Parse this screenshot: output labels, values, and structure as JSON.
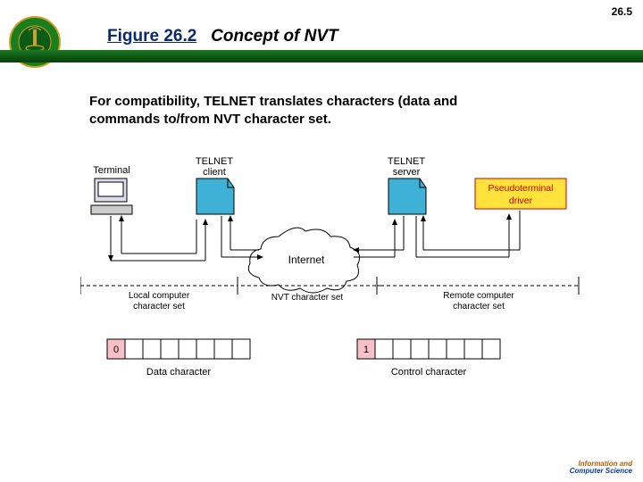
{
  "page_number": "26.5",
  "figure_label": "Figure 26.2",
  "figure_title": "Concept of NVT",
  "body_text": "For compatibility, TELNET translates characters (data and commands to/from NVT character set.",
  "diagram": {
    "terminal": "Terminal",
    "client": "TELNET\nclient",
    "server": "TELNET\nserver",
    "pseudo": "Pseudoterminal\ndriver",
    "internet": "Internet",
    "local_set": "Local computer\ncharacter set",
    "nvt_set": "NVT character set",
    "remote_set": "Remote computer\ncharacter set",
    "data_char": "Data character",
    "control_char": "Control character",
    "bit0": "0",
    "bit1": "1"
  },
  "footer": {
    "l1": "Information and",
    "l2": "Computer Science"
  }
}
